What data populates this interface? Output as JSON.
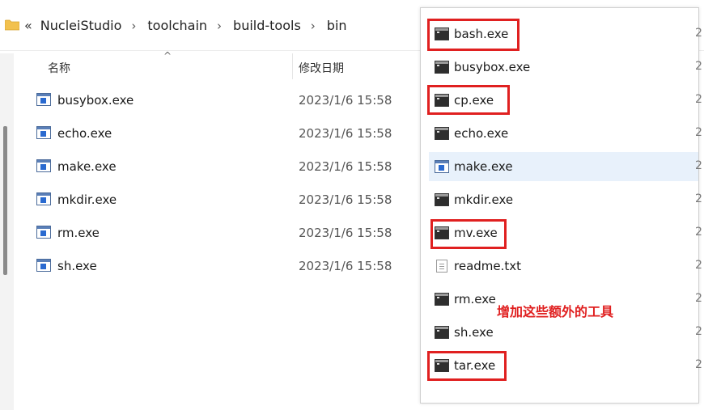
{
  "address_bar": {
    "overflow_chevron": "«",
    "path": [
      "NucleiStudio",
      "toolchain",
      "build-tools",
      "bin"
    ],
    "separator": "›"
  },
  "left_list": {
    "header": {
      "name": "名称",
      "date": "修改日期",
      "sort_indicator": "^"
    },
    "files": [
      {
        "name": "busybox.exe",
        "date": "2023/1/6 15:58",
        "icon": "exe-icon"
      },
      {
        "name": "echo.exe",
        "date": "2023/1/6 15:58",
        "icon": "exe-icon"
      },
      {
        "name": "make.exe",
        "date": "2023/1/6 15:58",
        "icon": "exe-icon"
      },
      {
        "name": "mkdir.exe",
        "date": "2023/1/6 15:58",
        "icon": "exe-icon"
      },
      {
        "name": "rm.exe",
        "date": "2023/1/6 15:58",
        "icon": "exe-icon"
      },
      {
        "name": "sh.exe",
        "date": "2023/1/6 15:58",
        "icon": "exe-icon"
      }
    ]
  },
  "right_list": {
    "files": [
      {
        "name": "bash.exe",
        "icon": "console-icon",
        "highlighted_box": true,
        "edge": "2"
      },
      {
        "name": "busybox.exe",
        "icon": "console-icon",
        "highlighted_box": false,
        "edge": "2"
      },
      {
        "name": "cp.exe",
        "icon": "console-icon",
        "highlighted_box": true,
        "edge": "2"
      },
      {
        "name": "echo.exe",
        "icon": "console-icon",
        "highlighted_box": false,
        "edge": "2"
      },
      {
        "name": "make.exe",
        "icon": "exe-icon",
        "highlighted_box": false,
        "edge": "2",
        "selected": true
      },
      {
        "name": "mkdir.exe",
        "icon": "console-icon",
        "highlighted_box": false,
        "edge": "2"
      },
      {
        "name": "mv.exe",
        "icon": "console-icon",
        "highlighted_box": true,
        "edge": "2"
      },
      {
        "name": "readme.txt",
        "icon": "text-file-icon",
        "highlighted_box": false,
        "edge": "2"
      },
      {
        "name": "rm.exe",
        "icon": "console-icon",
        "highlighted_box": false,
        "edge": "2"
      },
      {
        "name": "sh.exe",
        "icon": "console-icon",
        "highlighted_box": false,
        "edge": "2"
      },
      {
        "name": "tar.exe",
        "icon": "console-icon",
        "highlighted_box": true,
        "edge": "2"
      }
    ]
  },
  "annotation": {
    "text": "增加这些额外的工具",
    "color": "#e02020"
  },
  "colors": {
    "highlight_box": "#e02020",
    "selected_row": "#e8f1fb",
    "folder": "#f2c14e"
  }
}
